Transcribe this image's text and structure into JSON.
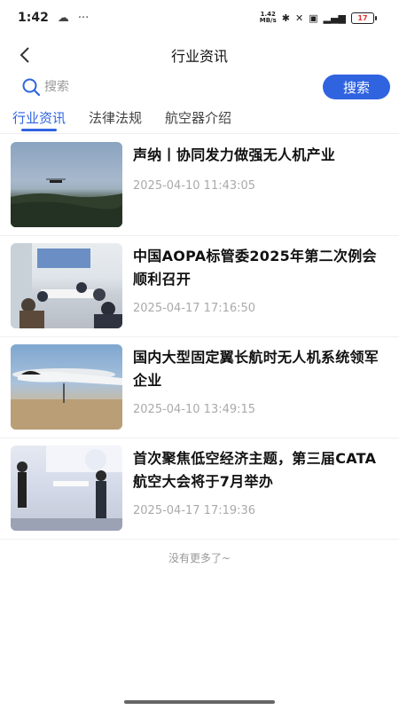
{
  "status": {
    "time": "1:42",
    "net_speed": "1.42 MB/s",
    "battery": "17"
  },
  "nav": {
    "title": "行业资讯"
  },
  "search": {
    "placeholder": "搜索",
    "button_label": "搜索"
  },
  "tabs": [
    {
      "label": "行业资讯",
      "active": true
    },
    {
      "label": "法律法规",
      "active": false
    },
    {
      "label": "航空器介绍",
      "active": false
    }
  ],
  "news": [
    {
      "title": "声纳丨协同发力做强无人机产业",
      "date": "2025-04-10 11:43:05"
    },
    {
      "title": "中国AOPA标管委2025年第二次例会顺利召开",
      "date": "2025-04-17 17:16:50"
    },
    {
      "title": "国内大型固定翼长航时无人机系统领军企业",
      "date": "2025-04-10 13:49:15"
    },
    {
      "title": "首次聚焦低空经济主题，第三届CATA航空大会将于7月举办",
      "date": "2025-04-17 17:19:36"
    }
  ],
  "list_end_text": "没有更多了~",
  "colors": {
    "accent": "#2f63e0"
  }
}
